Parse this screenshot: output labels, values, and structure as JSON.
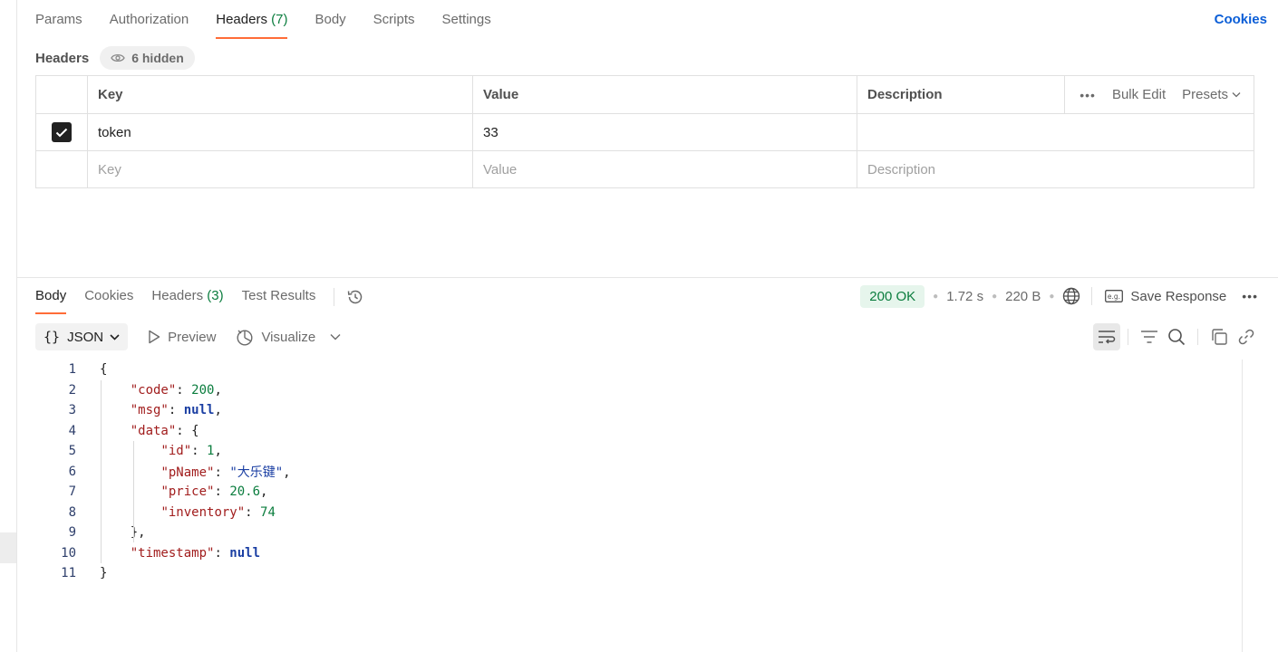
{
  "request": {
    "tabs": [
      {
        "label": "Params"
      },
      {
        "label": "Authorization"
      },
      {
        "label": "Headers",
        "count": "(7)"
      },
      {
        "label": "Body"
      },
      {
        "label": "Scripts"
      },
      {
        "label": "Settings"
      }
    ],
    "active_tab": "Headers",
    "cookies_link": "Cookies"
  },
  "headers_section": {
    "title": "Headers",
    "hidden_badge": "6 hidden",
    "columns": {
      "key": "Key",
      "value": "Value",
      "description": "Description"
    },
    "bulk_edit": "Bulk Edit",
    "presets": "Presets",
    "rows": [
      {
        "checked": true,
        "key": "token",
        "value": "33",
        "description": ""
      }
    ],
    "placeholders": {
      "key": "Key",
      "value": "Value",
      "description": "Description"
    }
  },
  "response": {
    "tabs": [
      {
        "label": "Body"
      },
      {
        "label": "Cookies"
      },
      {
        "label": "Headers",
        "count": "(3)"
      },
      {
        "label": "Test Results"
      }
    ],
    "active_tab": "Body",
    "status": "200 OK",
    "time": "1.72 s",
    "size": "220 B",
    "save_response": "Save Response",
    "format": "JSON",
    "preview": "Preview",
    "visualize": "Visualize",
    "lines": [
      {
        "n": "1",
        "indent": "",
        "parts": [
          {
            "t": "{",
            "c": "p"
          }
        ]
      },
      {
        "n": "2",
        "indent": "    ",
        "parts": [
          {
            "t": "\"code\"",
            "c": "k"
          },
          {
            "t": ": ",
            "c": "p"
          },
          {
            "t": "200",
            "c": "n"
          },
          {
            "t": ",",
            "c": "p"
          }
        ]
      },
      {
        "n": "3",
        "indent": "    ",
        "parts": [
          {
            "t": "\"msg\"",
            "c": "k"
          },
          {
            "t": ": ",
            "c": "p"
          },
          {
            "t": "null",
            "c": "nl"
          },
          {
            "t": ",",
            "c": "p"
          }
        ]
      },
      {
        "n": "4",
        "indent": "    ",
        "parts": [
          {
            "t": "\"data\"",
            "c": "k"
          },
          {
            "t": ": {",
            "c": "p"
          }
        ]
      },
      {
        "n": "5",
        "indent": "        ",
        "parts": [
          {
            "t": "\"id\"",
            "c": "k"
          },
          {
            "t": ": ",
            "c": "p"
          },
          {
            "t": "1",
            "c": "n"
          },
          {
            "t": ",",
            "c": "p"
          }
        ]
      },
      {
        "n": "6",
        "indent": "        ",
        "parts": [
          {
            "t": "\"pName\"",
            "c": "k"
          },
          {
            "t": ": ",
            "c": "p"
          },
          {
            "t": "\"大乐键\"",
            "c": "s"
          },
          {
            "t": ",",
            "c": "p"
          }
        ]
      },
      {
        "n": "7",
        "indent": "        ",
        "parts": [
          {
            "t": "\"price\"",
            "c": "k"
          },
          {
            "t": ": ",
            "c": "p"
          },
          {
            "t": "20.6",
            "c": "n"
          },
          {
            "t": ",",
            "c": "p"
          }
        ]
      },
      {
        "n": "8",
        "indent": "        ",
        "parts": [
          {
            "t": "\"inventory\"",
            "c": "k"
          },
          {
            "t": ": ",
            "c": "p"
          },
          {
            "t": "74",
            "c": "n"
          }
        ]
      },
      {
        "n": "9",
        "indent": "    ",
        "parts": [
          {
            "t": "},",
            "c": "p"
          }
        ]
      },
      {
        "n": "10",
        "indent": "    ",
        "parts": [
          {
            "t": "\"timestamp\"",
            "c": "k"
          },
          {
            "t": ": ",
            "c": "p"
          },
          {
            "t": "null",
            "c": "nl"
          }
        ]
      },
      {
        "n": "11",
        "indent": "",
        "parts": [
          {
            "t": "}",
            "c": "p"
          }
        ]
      }
    ]
  },
  "colors": {
    "accent": "#ff6c37",
    "status_ok": "#0b7d3e",
    "link": "#0b5ed7"
  }
}
